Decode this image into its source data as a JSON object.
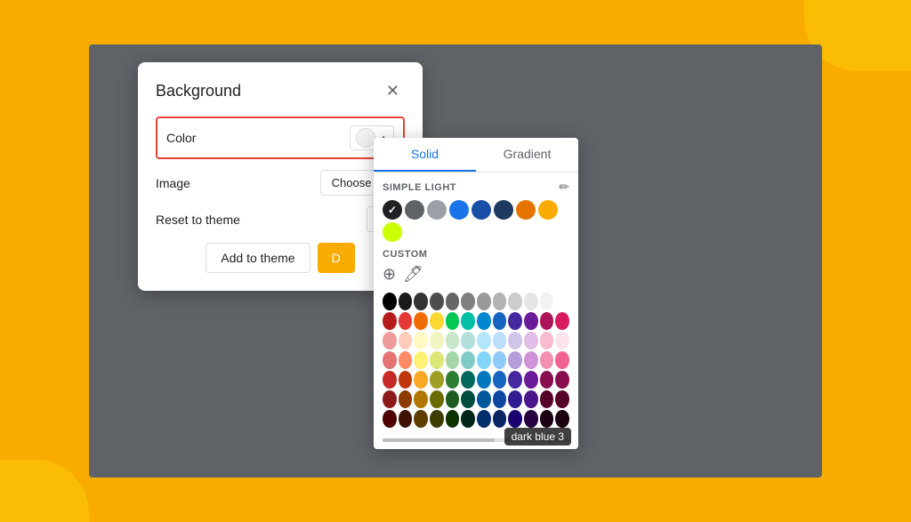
{
  "background": "#F9AB00",
  "dialog": {
    "title": "Background",
    "color_label": "Color",
    "image_label": "Image",
    "choose_image_label": "Choose ima",
    "reset_label": "Reset to theme",
    "reset_btn_label": "Re",
    "add_theme_label": "Add to theme",
    "done_label": "D"
  },
  "color_picker": {
    "tab_solid": "Solid",
    "tab_gradient": "Gradient",
    "simple_light_title": "SIMPLE LIGHT",
    "custom_title": "CUSTOM",
    "tooltip_text": "dark blue 3"
  },
  "theme_colors": [
    {
      "color": "#202124",
      "selected": true
    },
    {
      "color": "#5f6368",
      "selected": false
    },
    {
      "color": "#9aa0a6",
      "selected": false
    },
    {
      "color": "#1a73e8",
      "selected": false
    },
    {
      "color": "#174ea6",
      "selected": false
    },
    {
      "color": "#1e3a5f",
      "selected": false
    },
    {
      "color": "#e37400",
      "selected": false
    },
    {
      "color": "#F9AB00",
      "selected": false
    },
    {
      "color": "#ccff00",
      "selected": false
    }
  ],
  "color_grid": [
    [
      "#000000",
      "#1a1a1a",
      "#333333",
      "#4d4d4d",
      "#666666",
      "#808080",
      "#999999",
      "#b3b3b3",
      "#cccccc",
      "#e6e6e6",
      "#f2f2f2",
      "#ffffff"
    ],
    [
      "#b71c1c",
      "#e53935",
      "#ef6c00",
      "#fdd835",
      "#00c853",
      "#00bfa5",
      "#0288d1",
      "#1565c0",
      "#4527a0",
      "#6a1b9a",
      "#ad1457",
      "#d81b60"
    ],
    [
      "#ef9a9a",
      "#ffccbc",
      "#fff9c4",
      "#f0f4c3",
      "#c8e6c9",
      "#b2dfdb",
      "#b3e5fc",
      "#bbdefb",
      "#d1c4e9",
      "#e1bee7",
      "#f8bbd0",
      "#fce4ec"
    ],
    [
      "#e57373",
      "#ff8a65",
      "#fff176",
      "#dce775",
      "#a5d6a7",
      "#80cbc4",
      "#81d4fa",
      "#90caf9",
      "#b39ddb",
      "#ce93d8",
      "#f48fb1",
      "#f06292"
    ],
    [
      "#c62828",
      "#bf360c",
      "#f9a825",
      "#9e9d24",
      "#2e7d32",
      "#00695c",
      "#0277bd",
      "#1565c0",
      "#4527a0",
      "#6a1b9a",
      "#880e4f",
      "#880e4f"
    ],
    [
      "#8d1a1a",
      "#8c3a00",
      "#b07800",
      "#6b6b00",
      "#1b5e20",
      "#004d40",
      "#01579b",
      "#0d47a1",
      "#311b92",
      "#4a148c",
      "#560027",
      "#560027"
    ],
    [
      "#4e0000",
      "#3e1200",
      "#5f3e00",
      "#3d3d00",
      "#0a3300",
      "#00251a",
      "#002f6c",
      "#0a2463",
      "#1a0070",
      "#270040",
      "#1a0011",
      "#1a0011"
    ]
  ]
}
